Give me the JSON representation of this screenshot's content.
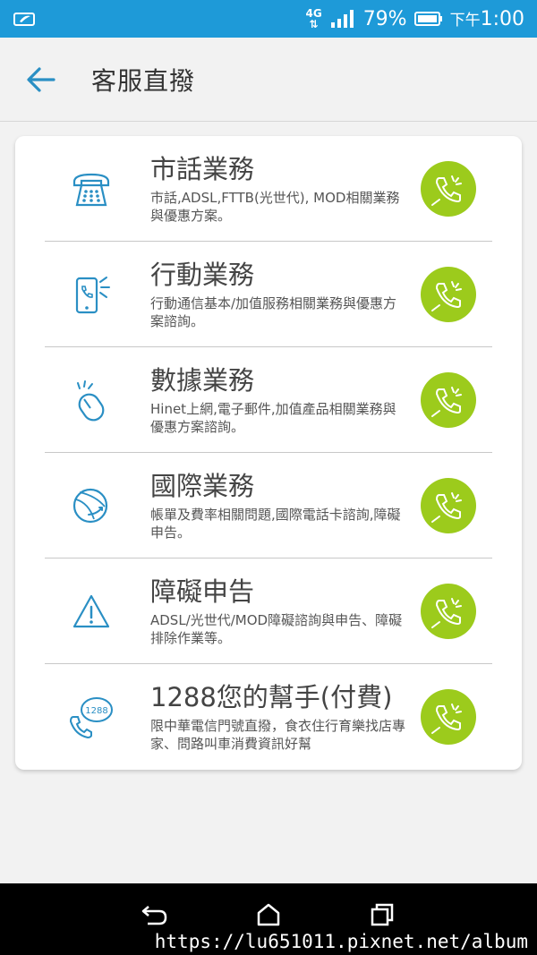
{
  "status_bar": {
    "network": "4G",
    "battery": "79%",
    "time_prefix": "下午",
    "time": "1:00"
  },
  "header": {
    "title": "客服直撥"
  },
  "services": [
    {
      "title": "市話業務",
      "desc": "市話,ADSL,FTTB(光世代), MOD相關業務與優惠方案。",
      "icon": "telephone-icon"
    },
    {
      "title": "行動業務",
      "desc": "行動通信基本/加值服務相關業務與優惠方案諮詢。",
      "icon": "mobile-phone-icon"
    },
    {
      "title": "數據業務",
      "desc": "Hinet上網,電子郵件,加值產品相關業務與優惠方案諮詢。",
      "icon": "mouse-icon"
    },
    {
      "title": "國際業務",
      "desc": "帳單及費率相關問題,國際電話卡諮詢,障礙申告。",
      "icon": "globe-icon"
    },
    {
      "title": "障礙申告",
      "desc": "ADSL/光世代/MOD障礙諮詢與申告、障礙排除作業等。",
      "icon": "warning-icon"
    },
    {
      "title": "1288您的幫手(付費)",
      "desc": "限中華電信門號直撥，食衣住行育樂找店專家、問路叫車消費資訊好幫",
      "icon": "hotline-1288-icon",
      "badge": "1288"
    }
  ],
  "colors": {
    "status_bar": "#1e9ad8",
    "accent": "#2a8fc4",
    "call_button": "#9ccb1c",
    "background": "#f2f2f2"
  },
  "watermark": "https://lu651011.pixnet.net/album"
}
